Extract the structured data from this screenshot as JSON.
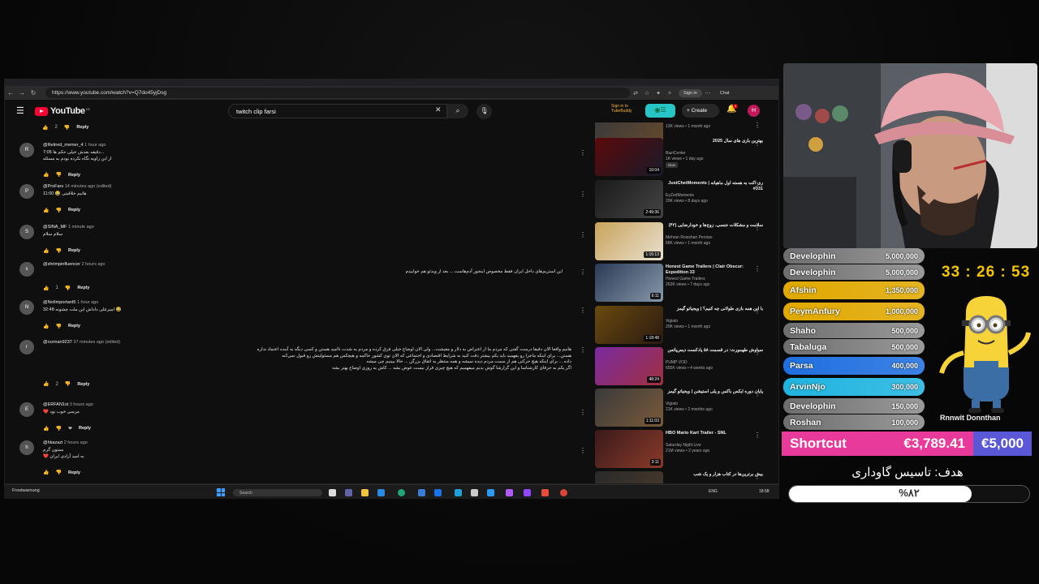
{
  "browser": {
    "url": "https://www.youtube.com/watch?v=Q7do45yjDsg",
    "signin_label": "Sign in",
    "chat_label": "Chat"
  },
  "youtube": {
    "logo_text": "YouTube",
    "logo_country": "DE",
    "search_query": "twitch clip farsi",
    "tubebuddy_label": "Sign in to TubeBuddy",
    "create_label": "Create",
    "notification_count": "9",
    "avatar_letter": "H"
  },
  "top_reply": {
    "likes": "2",
    "reply_label": "Reply"
  },
  "comments": [
    {
      "author": "@Retired_memer_4",
      "time": "1 hour ago",
      "avatar": "R",
      "lines": [
        "7:05 دقیقه بعدش خیلی حکم ها...",
        "از این زاویه نگاه نکرده بودم به مسئله"
      ],
      "likes": "",
      "reply_label": "Reply"
    },
    {
      "author": "@ProFars",
      "time": "14 minutes ago (edited)",
      "avatar": "P",
      "lines": [
        "11:00 😂 هانیم خلاقیتی"
      ],
      "likes": "",
      "reply_label": "Reply"
    },
    {
      "author": "@SINA_MF",
      "time": "1 minute ago",
      "avatar": "S",
      "lines": [
        "سلام سلام"
      ],
      "likes": "",
      "reply_label": "Reply"
    },
    {
      "author": "@shrimpinfluencer",
      "time": "2 hours ago",
      "avatar": "s",
      "lines": [
        "این استریم‌های داخل ایران فقط مخصوص اینجور آدم‌هاست ... بعد از ویدئو هم خوابیدم"
      ],
      "likes": "1",
      "reply_label": "Reply"
    },
    {
      "author": "@NotImportant5",
      "time": "1 hour ago",
      "avatar": "N",
      "lines": [
        "32:48 امیرعلی داداش این ملت چشونه 😂"
      ],
      "likes": "",
      "reply_label": "Reply"
    },
    {
      "author": "@rzzman9237",
      "time": "37 minutes ago (edited)",
      "avatar": "r",
      "lines": [
        "هانیم واقعا الان دقیقا درست گفتی که مردم ما از اعتراض به دلار و معیشت... ولی الان اوضاع خیلی فرق کرده و مردم به شدت ناامید هستن و کسی دیگه به آینده اعتماد نداره",
        "هستن... برای اینکه ماجرا رو بفهمید باید یکم بیشتر دقت کنید به شرایط اقتصادی و اجتماعی که الان توی کشور حاکمه و هیچکس هم مسئولیتش رو قبول نمی‌کنه",
        "داده ... برای اینکه هیچ حرکتی هم از سمت مردم دیده نمیشه و همه منتظر یه اتفاق بزرگن ... حالا ببینیم چی میشه",
        "اگر یکم به حرفای کارشناسا و این گزارشا گوش بدیم میفهمیم که هیچ چیزی قرار نیست عوض بشه ... کاش یه روزی اوضاع بهتر بشه"
      ],
      "likes": "2",
      "reply_label": "Reply"
    },
    {
      "author": "@ERFAN1st",
      "time": "3 hours ago",
      "avatar": "E",
      "lines": [
        "❤️ مرسی خوب بود"
      ],
      "likes": "",
      "reply_label": "Reply"
    },
    {
      "author": "@hkazazi",
      "time": "2 hours ago",
      "avatar": "h",
      "lines": [
        "ممنون گرم",
        "❤️ به امید آزادی ایران"
      ],
      "likes": "",
      "reply_label": "Reply"
    }
  ],
  "sidebar_videos": [
    {
      "title": "",
      "channel": "",
      "meta": "13K views • 1 month ago",
      "duration": "1:31:05",
      "colors": [
        "#3a3a3a",
        "#6a4a2a"
      ],
      "new": false
    },
    {
      "title": "بهترین بازی های سال 2025",
      "channel": "BaziCenter",
      "meta": "1K views • 1 day ago",
      "duration": "10:04",
      "colors": [
        "#5a0a0a",
        "#1a1a2a"
      ],
      "new": true,
      "new_label": "New"
    },
    {
      "title": "ری اکت به هسته اول ماهیانه | JustChetMoments #331",
      "channel": "EyZedMoments",
      "meta": "29K views • 8 days ago",
      "duration": "2:49:36",
      "colors": [
        "#1a1a1a",
        "#444"
      ],
      "new": false
    },
    {
      "title": "سلامت و مشکلات جنسی، زوج‌ها و خودارضایی (۴۲)",
      "channel": "Mehran Rowshan Persian",
      "meta": "68K views • 1 month ago",
      "duration": "1:16:13",
      "colors": [
        "#c9a35a",
        "#e8e0d0"
      ],
      "new": false
    },
    {
      "title": "Honest Game Trailers | Clair Obscur: Expedition 33",
      "channel": "Honest Game Trailers",
      "meta": "263K views • 7 days ago",
      "duration": "6:11",
      "colors": [
        "#2a3a55",
        "#8898aa"
      ],
      "new": false
    },
    {
      "title": "با این همه بازی طولانی چه کنیم؟ | ویجیاتو گیمز",
      "channel": "Vigiato",
      "meta": "20K views • 1 month ago",
      "duration": "1:18:48",
      "colors": [
        "#6a4a10",
        "#2a1a10"
      ],
      "new": false
    },
    {
      "title": "سیاوش طهمورث: در قسمت ۵۸ پادکست دیس‌پاتس",
      "channel": "PUMP VOD",
      "meta": "655K views • 4 weeks ago",
      "duration": "48:24",
      "colors": [
        "#7a2aa0",
        "#a03040"
      ],
      "new": false
    },
    {
      "title": "پایان دوره ایکس باکس و پلی استیشن | ویجیاتو گیمز",
      "channel": "Vigiato",
      "meta": "21K views • 2 months ago",
      "duration": "1:11:03",
      "colors": [
        "#3a3a3a",
        "#7a5a3a"
      ],
      "new": false
    },
    {
      "title": "HBO Mario Kart Trailer - SNL",
      "channel": "Saturday Night Live",
      "meta": "21M views • 2 years ago",
      "duration": "3:11",
      "colors": [
        "#3a1a1a",
        "#8a3a2a"
      ],
      "new": false
    },
    {
      "title": "بیش برترین‌ها در کتاب هزار و یک شب",
      "channel": "",
      "meta": "",
      "duration": "",
      "colors": [
        "#2a2a2a",
        "#4a3a2a"
      ],
      "new": false
    }
  ],
  "taskbar": {
    "weather": "Frostwarnung",
    "search_placeholder": "Search",
    "lang": "ENG",
    "time": "18:58"
  },
  "leaderboard": [
    {
      "name": "Develophin",
      "amount": "5,000,000",
      "color": "#8a8a8a"
    },
    {
      "name": "Develophin",
      "amount": "5,000,000",
      "color": "#8a8a8a"
    },
    {
      "name": "Afshin",
      "amount": "1,350,000",
      "color": "#e0a800"
    },
    {
      "name": "PeymAnfury",
      "amount": "1,000,000",
      "color": "#e0a800"
    },
    {
      "name": "Shaho",
      "amount": "500,000",
      "color": "#8a8a8a"
    },
    {
      "name": "Tabaluga",
      "amount": "500,000",
      "color": "#8a8a8a"
    },
    {
      "name": "Parsa",
      "amount": "400,000",
      "color": "#1f6fe0"
    },
    {
      "name": "ArvinNjo",
      "amount": "300,000",
      "color": "#1fb4e0"
    },
    {
      "name": "Develophin",
      "amount": "150,000",
      "color": "#8a8a8a"
    },
    {
      "name": "Roshan",
      "amount": "100,000",
      "color": "#8a8a8a"
    }
  ],
  "timer": "33 : 26 : 53",
  "random_label": "Rnnwit Donnthan",
  "goal": {
    "label": "Shortcut",
    "current": "€3,789.41",
    "target": "€5,000",
    "title": "هدف: تاسیس گاوداری",
    "percent_label": "%۸۲",
    "fraction": 0.76
  },
  "colors": {
    "youtube_red": "#ff0033",
    "accent_pink": "#e83a9a",
    "accent_indigo": "#5a58d6",
    "timer_yellow": "#f5c400"
  },
  "icons": [
    "back-icon",
    "forward-icon",
    "reload-icon",
    "search-icon",
    "mic-icon",
    "bell-icon",
    "menu-icon",
    "like-icon",
    "dislike-icon",
    "kebab-icon",
    "windows-icon"
  ]
}
